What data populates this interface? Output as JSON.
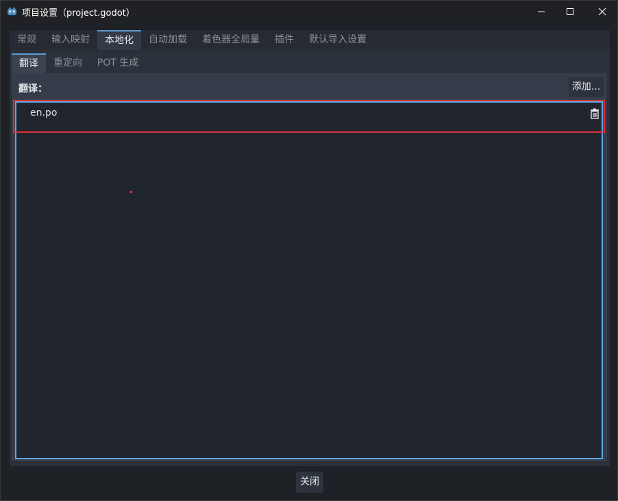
{
  "window": {
    "title": "项目设置（project.godot）",
    "minimize_icon": "minimize-icon",
    "maximize_icon": "maximize-icon",
    "close_icon": "close-icon"
  },
  "tabs": [
    {
      "label": "常规",
      "active": false
    },
    {
      "label": "输入映射",
      "active": false
    },
    {
      "label": "本地化",
      "active": true
    },
    {
      "label": "自动加载",
      "active": false
    },
    {
      "label": "着色器全局量",
      "active": false
    },
    {
      "label": "插件",
      "active": false
    },
    {
      "label": "默认导入设置",
      "active": false
    }
  ],
  "subtabs": [
    {
      "label": "翻译",
      "active": true
    },
    {
      "label": "重定向",
      "active": false
    },
    {
      "label": "POT 生成",
      "active": false
    }
  ],
  "translations": {
    "label": "翻译：",
    "add_button": "添加...",
    "files": [
      {
        "name": "en.po",
        "delete_icon": "trash-icon"
      }
    ]
  },
  "footer": {
    "close_button": "关闭"
  },
  "colors": {
    "accent": "#5aa8e6",
    "highlight": "#e0303b",
    "background": "#21252d"
  }
}
